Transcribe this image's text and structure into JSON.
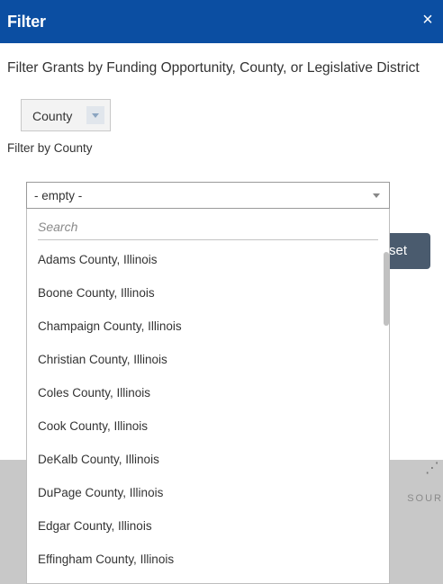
{
  "header": {
    "title": "Filter",
    "close_glyph": "×"
  },
  "description": "Filter Grants by Funding Opportunity, County, or Legislative District",
  "mode_select": {
    "selected": "County",
    "icon": "chevron-down-icon"
  },
  "filter_label": "Filter by County",
  "county_combo": {
    "value": "- empty -",
    "icon": "caret-down-icon"
  },
  "apply_button": {
    "label": "set"
  },
  "map_decor": {
    "icon_glyph": "⋰",
    "text": "SOUR"
  },
  "dropdown": {
    "search_placeholder": "Search",
    "items": [
      "Adams County, Illinois",
      "Boone County, Illinois",
      "Champaign County, Illinois",
      "Christian County, Illinois",
      "Coles County, Illinois",
      "Cook County, Illinois",
      "DeKalb County, Illinois",
      "DuPage County, Illinois",
      "Edgar County, Illinois",
      "Effingham County, Illinois"
    ]
  },
  "colors": {
    "header_bg": "#0b4ea2",
    "button_bg": "#4a5b6e",
    "map_bg": "#c8c8c8"
  }
}
